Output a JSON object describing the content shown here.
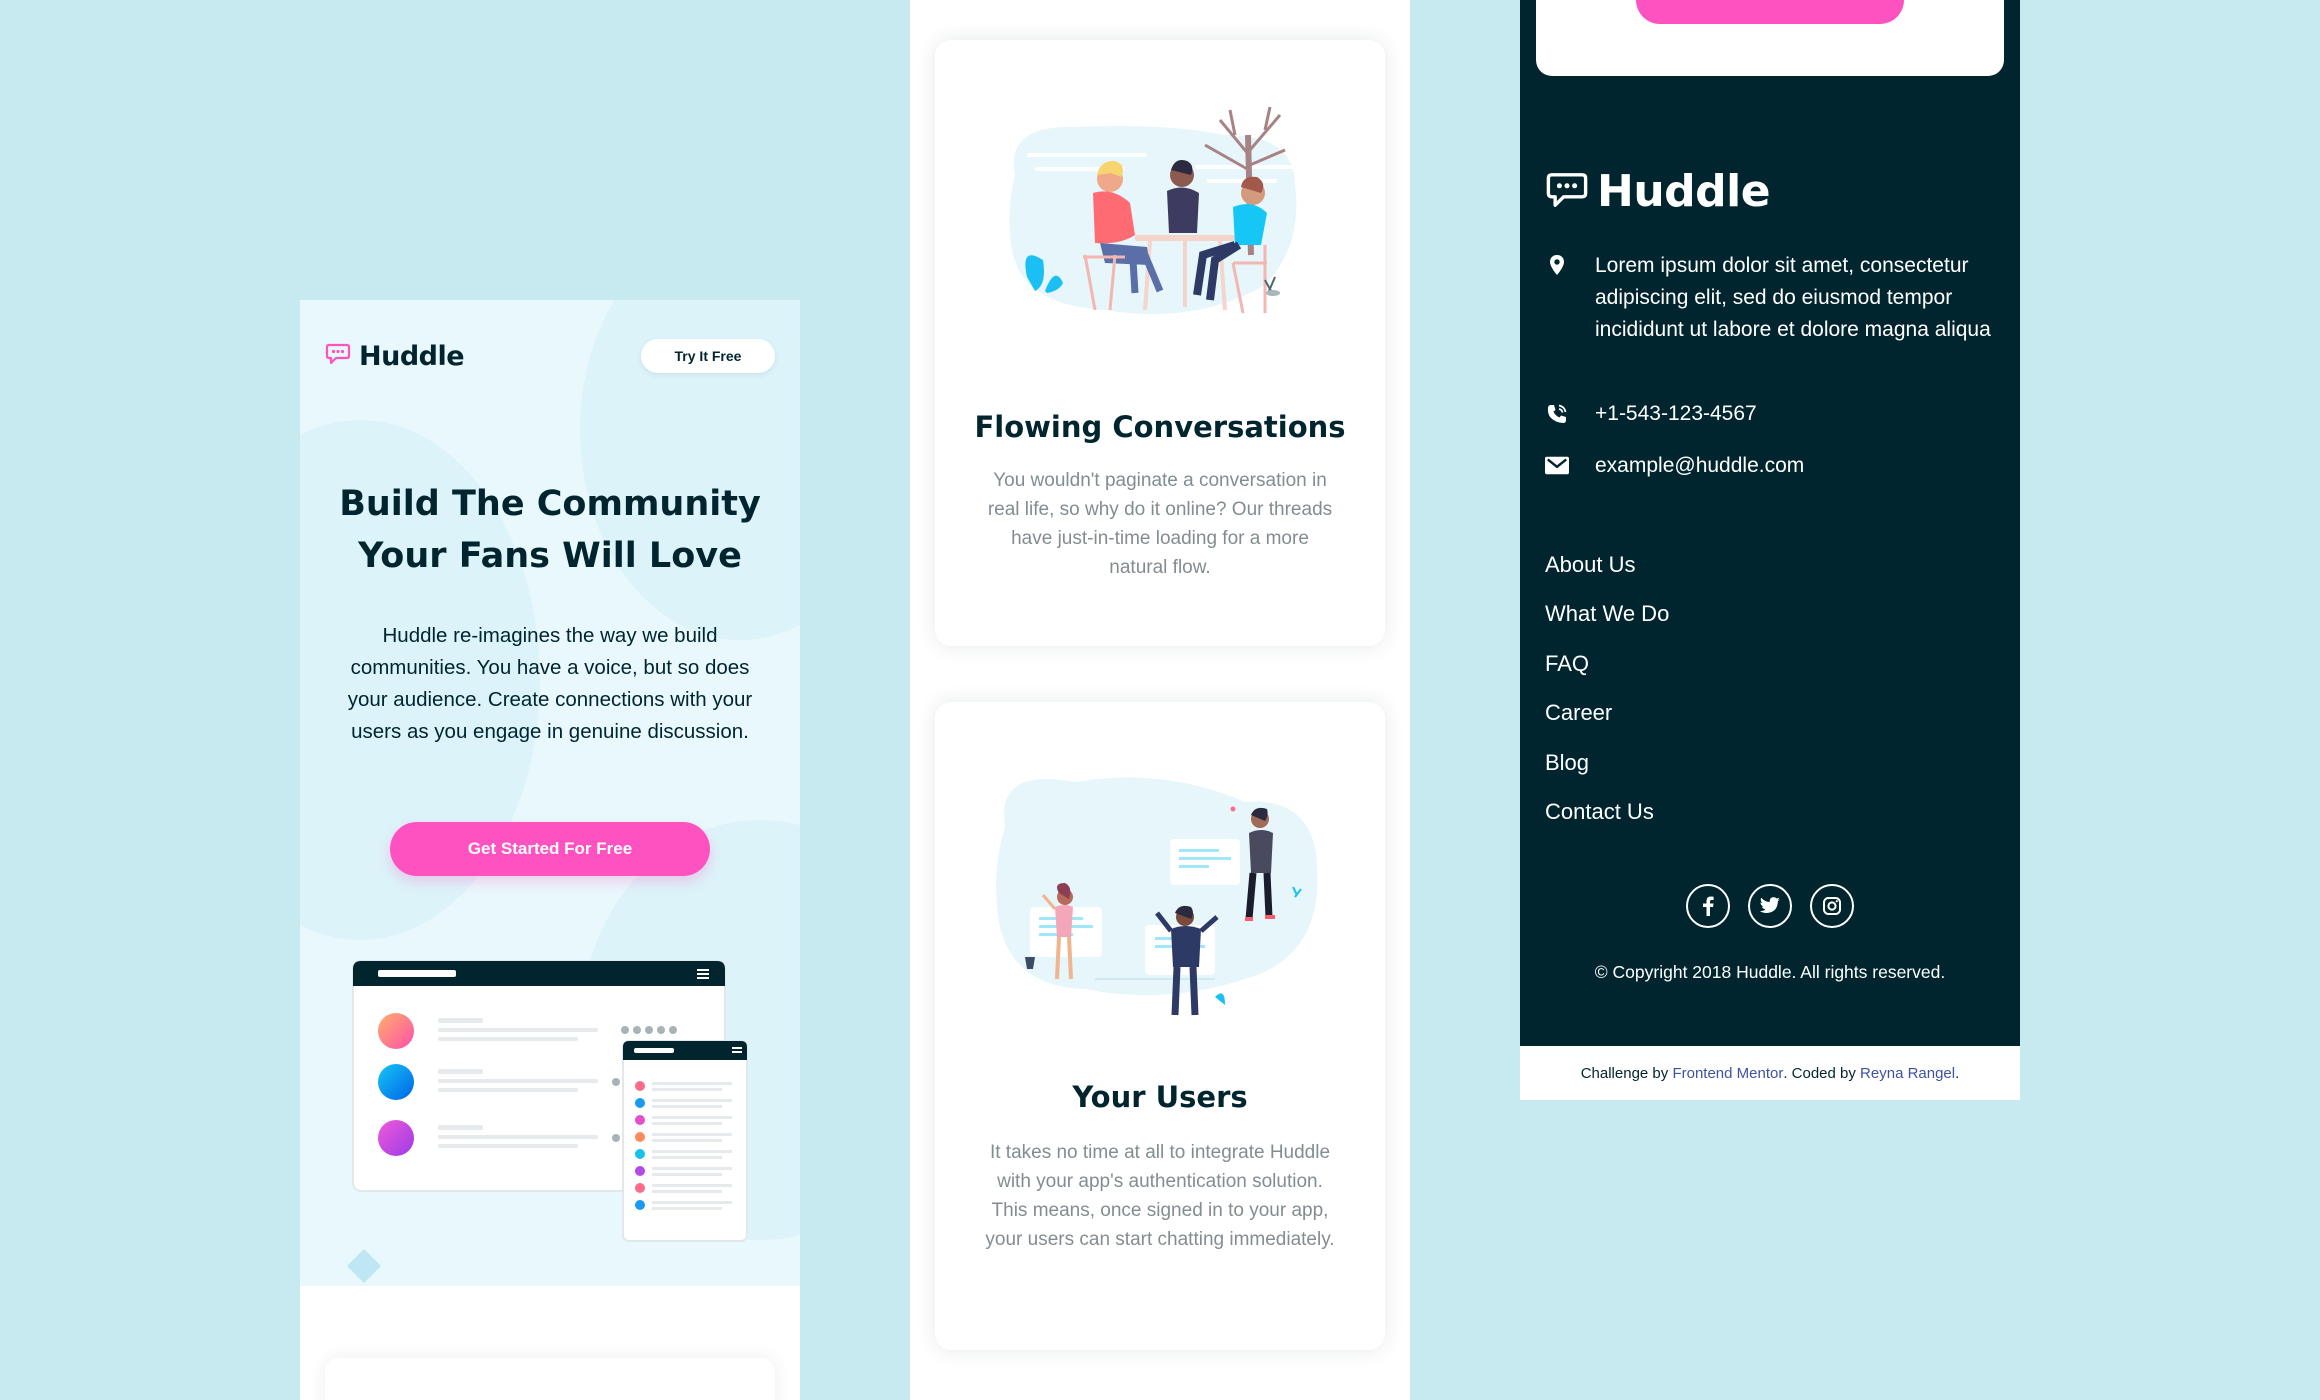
{
  "brand": {
    "name": "Huddle",
    "colors": {
      "navy": "#00252e",
      "pink": "#ff52c1",
      "pale_blue": "#e9f8fc",
      "page_bg": "#c7e9f0"
    }
  },
  "hero": {
    "try_button": "Try It Free",
    "title_line1": "Build The Community",
    "title_line2": "Your Fans Will Love",
    "text": "Huddle re-imagines the way we build communities. You have a voice, but so does your audience. Create connections with your users as you engage in genuine discussion.",
    "cta": "Get Started For Free"
  },
  "features": [
    {
      "title": "Flowing Conversations",
      "text": "You wouldn't paginate a conversation in real life, so why do it online? Our threads have just-in-time loading for a more natural flow.",
      "illustration": "people-talking-under-tree-illustration"
    },
    {
      "title": "Your Users",
      "text": "It takes no time at all to integrate Huddle with your app's authentication solution. This means, once signed in to your app, your users can start chatting immediately.",
      "illustration": "users-with-chat-bubbles-illustration"
    }
  ],
  "footer": {
    "address": "Lorem ipsum dolor sit amet, consectetur adipiscing elit, sed do eiusmod tempor incididunt ut labore et dolore magna aliqua",
    "phone": "+1-543-123-4567",
    "email": "example@huddle.com",
    "links": [
      "About Us",
      "What We Do",
      "FAQ",
      "Career",
      "Blog",
      "Contact Us"
    ],
    "social_icons": [
      "facebook-icon",
      "twitter-icon",
      "instagram-icon"
    ],
    "copyright": "© Copyright 2018 Huddle. All rights reserved.",
    "attribution": {
      "prefix": "Challenge by ",
      "challenge_link": "Frontend Mentor",
      "middle": ". Coded by ",
      "coder_link": "Reyna Rangel",
      "suffix": "."
    }
  }
}
